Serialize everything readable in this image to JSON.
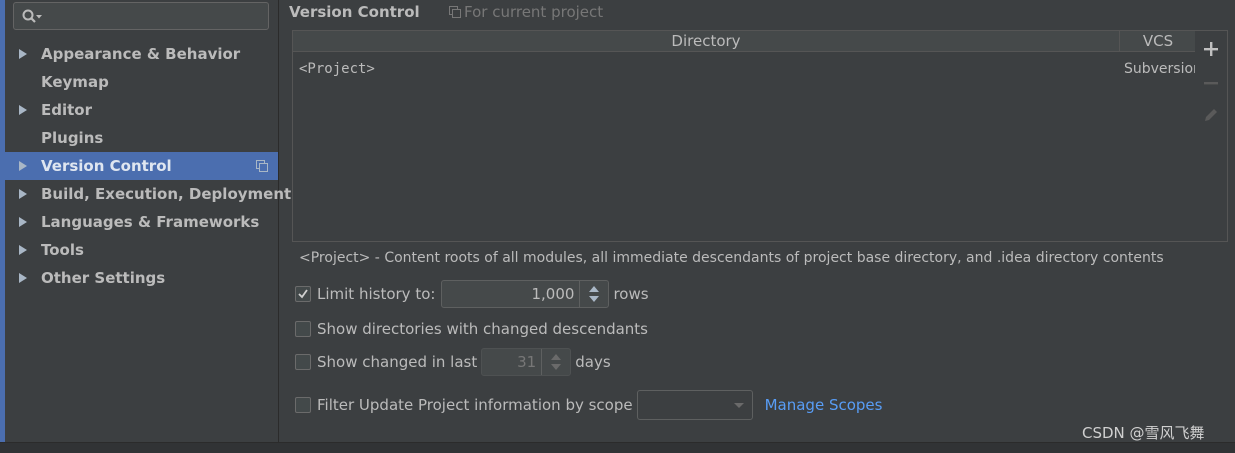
{
  "search": {
    "placeholder": ""
  },
  "sidebar": {
    "items": [
      {
        "label": "Appearance & Behavior",
        "expandable": true
      },
      {
        "label": "Keymap",
        "expandable": false
      },
      {
        "label": "Editor",
        "expandable": true
      },
      {
        "label": "Plugins",
        "expandable": false
      },
      {
        "label": "Version Control",
        "expandable": true,
        "selected": true
      },
      {
        "label": "Build, Execution, Deployment",
        "expandable": true
      },
      {
        "label": "Languages & Frameworks",
        "expandable": true
      },
      {
        "label": "Tools",
        "expandable": true
      },
      {
        "label": "Other Settings",
        "expandable": true
      }
    ]
  },
  "header": {
    "title": "Version Control",
    "scope_hint": "For current project"
  },
  "mappings": {
    "columns": [
      "Directory",
      "VCS"
    ],
    "rows": [
      {
        "directory": "<Project>",
        "vcs": "Subversion"
      }
    ]
  },
  "description": "<Project> - Content roots of all modules, all immediate descendants of project base directory, and .idea directory contents",
  "options": {
    "limit_history": {
      "label": "Limit history to:",
      "checked": true,
      "value": "1,000",
      "unit": "rows"
    },
    "show_dirs": {
      "label": "Show directories with changed descendants",
      "checked": false
    },
    "show_changed": {
      "label": "Show changed in last",
      "checked": false,
      "value": "31",
      "unit": "days"
    },
    "filter_update": {
      "label": "Filter Update Project information by scope",
      "checked": false,
      "link": "Manage Scopes"
    }
  },
  "watermark": "CSDN @雪风飞舞",
  "colors": {
    "accent": "#4b6eaf",
    "link": "#589df6",
    "annotation_arrow": "#e84545",
    "background": "#3c3f41"
  }
}
